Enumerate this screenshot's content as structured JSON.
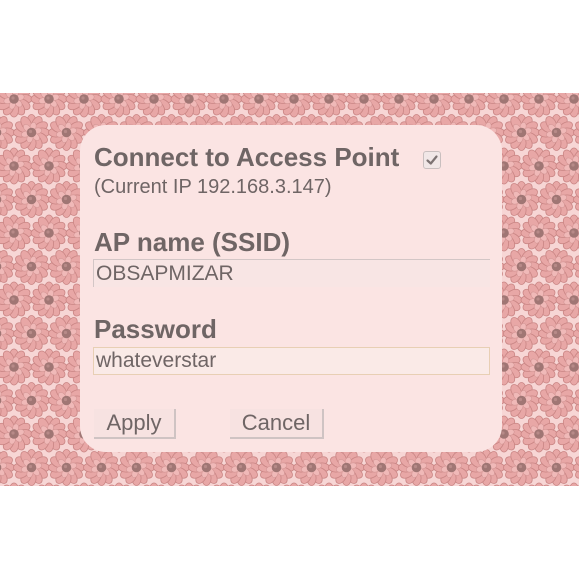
{
  "background": {
    "pattern_icon": "pink-flower-tile-icon",
    "colors": {
      "page": "#ffffff",
      "pattern_base": "#f7d6d5",
      "petal": "#e8a7a6",
      "petal_outline": "#c98584",
      "flower_center": "#a07674"
    }
  },
  "dialog": {
    "title": "Connect to Access Point",
    "connect_checked": true,
    "current_ip": "(Current IP 192.168.3.147)",
    "ssid_label": "AP name (SSID)",
    "ssid_value": "OBSAPMIZAR",
    "password_label": "Password",
    "password_value": "whateverstar",
    "apply_label": "Apply",
    "cancel_label": "Cancel",
    "colors": {
      "panel": "#fbe4e3",
      "text": "#6f6565"
    }
  }
}
